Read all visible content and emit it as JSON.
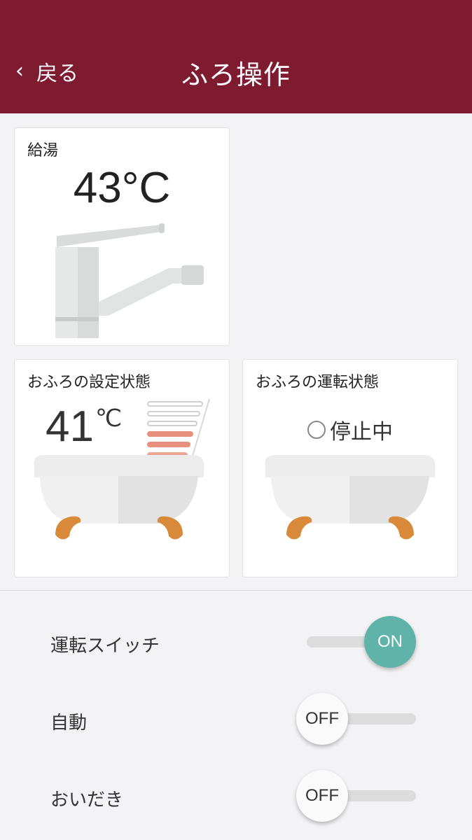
{
  "header": {
    "back_label": "戻る",
    "title": "ふろ操作",
    "bg_color": "#7f1b31"
  },
  "hot_water": {
    "title": "給湯",
    "temperature": "43°C"
  },
  "bath_setting": {
    "title": "おふろの設定状態",
    "temperature": "41",
    "unit": "℃",
    "level_total": 6,
    "level_filled": 3
  },
  "bath_running": {
    "title": "おふろの運転状態",
    "status": "停止中"
  },
  "controls": [
    {
      "label": "運転スイッチ",
      "state": "ON",
      "on": true
    },
    {
      "label": "自動",
      "state": "OFF",
      "on": false
    },
    {
      "label": "おいだき",
      "state": "OFF",
      "on": false
    }
  ],
  "colors": {
    "accent_on": "#5fb3a9",
    "level_fill": "#e8907e",
    "bath_feet": "#d88a3a"
  }
}
